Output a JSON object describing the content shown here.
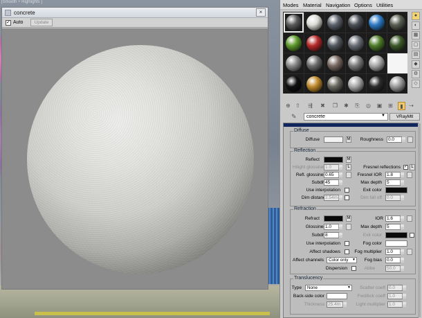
{
  "viewport": {
    "label": "[Smooth + Highlights ]"
  },
  "preview": {
    "title": "concrete",
    "close_glyph": "×",
    "auto_label": "Auto",
    "auto_checked": true,
    "update_label": "Update"
  },
  "menu": [
    "Modes",
    "Material",
    "Navigation",
    "Options",
    "Utilities"
  ],
  "slots": [
    {
      "color": "#5a5a5a",
      "active": true
    },
    {
      "color": "#dcdcd6"
    },
    {
      "color": "#5c626b"
    },
    {
      "color": "#4b5058"
    },
    {
      "color": "#2f7bc6"
    },
    {
      "color": "#5a5f52"
    },
    {
      "color": "#5f9a2c"
    },
    {
      "color": "#b72a2a"
    },
    {
      "color": "#555b62"
    },
    {
      "color": "#6a6f77"
    },
    {
      "color": "#4f7d2a"
    },
    {
      "color": "#3d5a2a"
    },
    {
      "color": "#8a8a8a"
    },
    {
      "color": "#6e6e6e"
    },
    {
      "color": "#7a6a62"
    },
    {
      "color": "#7d7d7d"
    },
    {
      "color": "#a9a9a9"
    },
    {
      "color": "#ffffff",
      "white": true
    },
    {
      "color": "#111111"
    },
    {
      "color": "#c08a2c"
    },
    {
      "color": "#6a6a60"
    },
    {
      "color": "#a8a8a8"
    },
    {
      "color": "#2c2c2c"
    },
    {
      "color": "#9c9c9c"
    }
  ],
  "material": {
    "name": "concrete",
    "type": "VRayMtl",
    "picker_glyph": "✎"
  },
  "diffuse": {
    "title": "Diffuse",
    "diffuse_label": "Diffuse",
    "diffuse_color": "#f2f2f2",
    "map_btn": "M",
    "roughness_label": "Roughness",
    "roughness": "0.0"
  },
  "reflection": {
    "title": "Reflection",
    "reflect_label": "Reflect",
    "reflect_color": "#0a0a0a",
    "map_btn": "M",
    "hilight_label": "Hilight glossiness",
    "hilight_value": "1.0",
    "lock_btn": "L",
    "fresnel_label": "Fresnel reflections",
    "fresnel_checked": true,
    "refl_gloss_label": "Refl. glossiness",
    "refl_gloss": "0.65",
    "fresnel_ior_label": "Fresnel IOR",
    "fresnel_ior": "1.8",
    "subdivs_label": "Subdivs",
    "subdivs": "45",
    "max_depth_label": "Max depth",
    "max_depth": "5",
    "use_interp_label": "Use interpolation",
    "exit_color_label": "Exit color",
    "exit_color": "#0a0a0a",
    "dim_distance_label": "Dim distance",
    "dim_distance": "2.54m",
    "dim_falloff_label": "Dim fall off",
    "dim_falloff": "0.0"
  },
  "refraction": {
    "title": "Refraction",
    "refract_label": "Refract",
    "refract_color": "#0a0a0a",
    "map_btn": "M",
    "ior_label": "IOR",
    "ior": "1.6",
    "gloss_label": "Glossiness",
    "gloss": "1.0",
    "max_depth_label": "Max depth",
    "max_depth": "5",
    "subdivs_label": "Subdivs",
    "subdivs": "8",
    "exit_color_label": "Exit color",
    "exit_color": "#0a0a0a",
    "use_interp_label": "Use interpolation",
    "fog_color_label": "Fog color",
    "fog_color": "#ffffff",
    "affect_shadows_label": "Affect shadows",
    "fog_mult_label": "Fog multiplier",
    "fog_mult": "1.0",
    "affect_channels_label": "Affect channels",
    "affect_channels": "Color only",
    "fog_bias_label": "Fog bias",
    "fog_bias": "0.0",
    "dispersion_label": "Dispersion",
    "abbe_label": "Abbe",
    "abbe": "50.0"
  },
  "translucency": {
    "title": "Translucency",
    "type_label": "Type",
    "type_value": "None",
    "scatter_label": "Scatter coeff",
    "scatter": "0.0",
    "backside_label": "Back-side color",
    "backside_color": "#ffffff",
    "fwd_bck_label": "Fwd/bck coeff",
    "fwd_bck": "1.0",
    "thickness_label": "Thickness",
    "thickness": "25.4m",
    "light_mult_label": "Light multiplier",
    "light_mult": "1.0"
  }
}
